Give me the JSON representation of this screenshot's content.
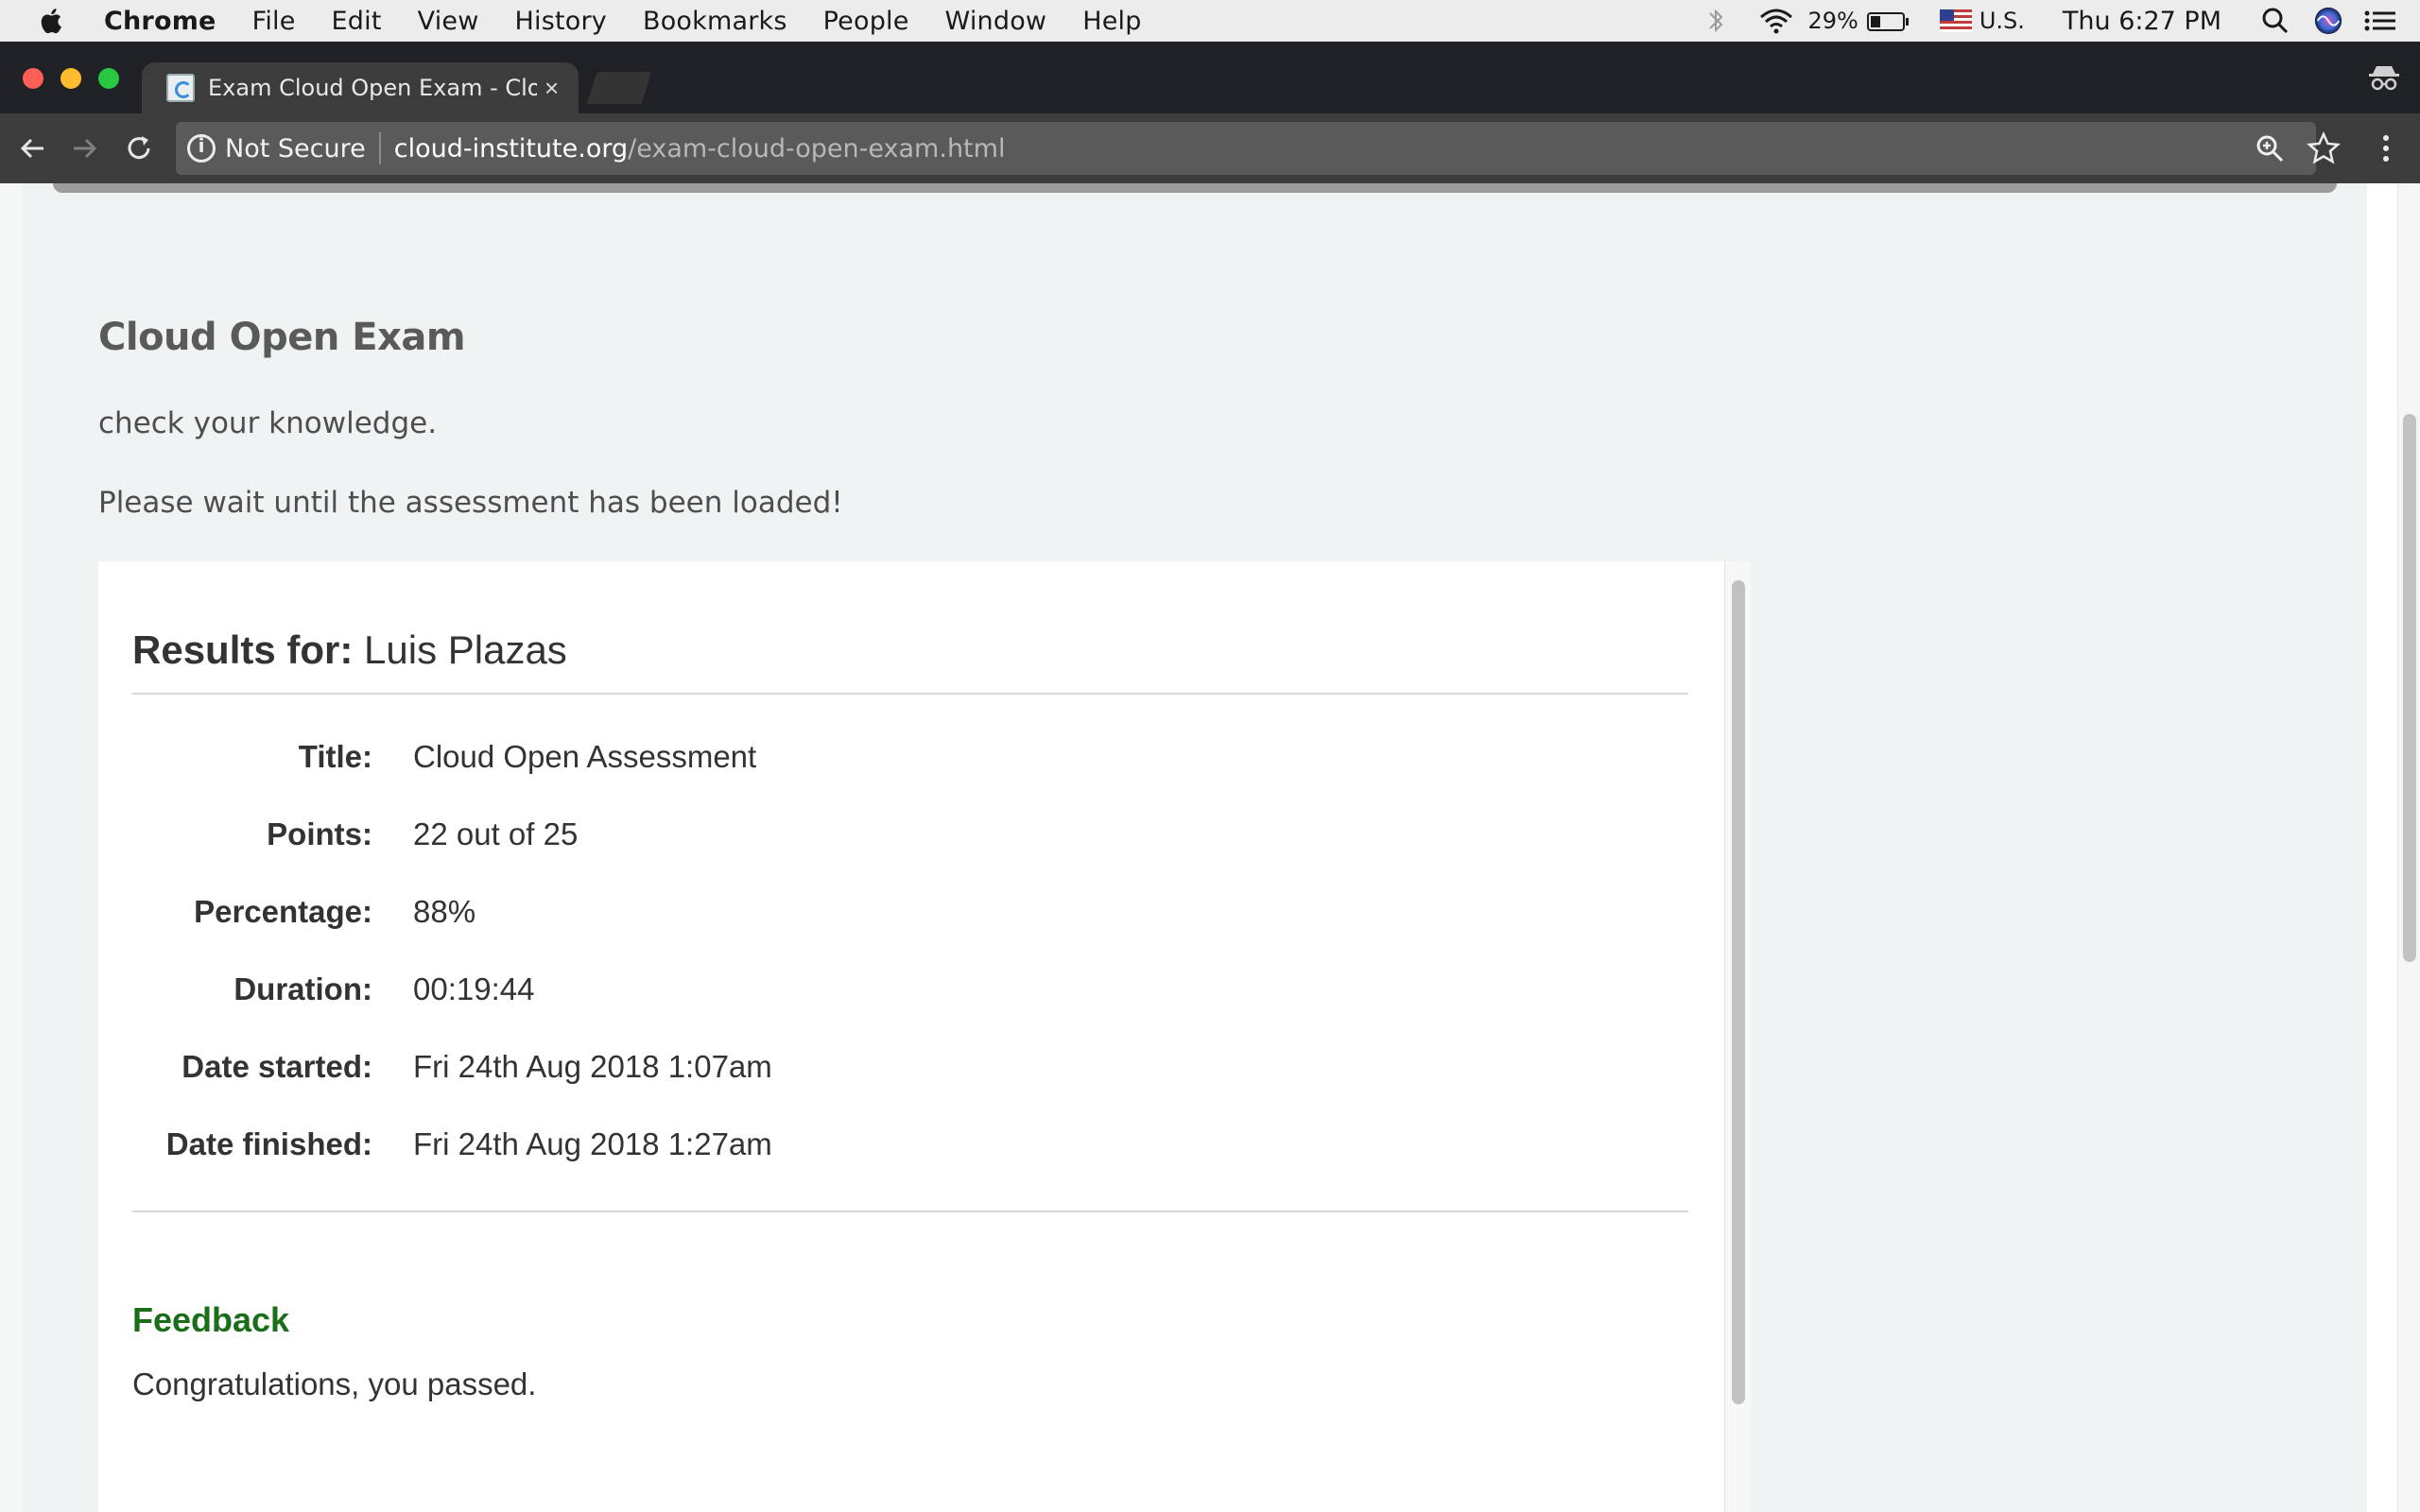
{
  "menubar": {
    "app": "Chrome",
    "items": [
      "File",
      "Edit",
      "View",
      "History",
      "Bookmarks",
      "People",
      "Window",
      "Help"
    ],
    "battery": "29%",
    "input_source": "U.S.",
    "clock": "Thu 6:27 PM"
  },
  "browser": {
    "tab_title": "Exam Cloud Open Exam - Clou",
    "tab_close": "×",
    "security_label": "Not Secure",
    "url_host": "cloud-institute.org",
    "url_path": "/exam-cloud-open-exam.html"
  },
  "page": {
    "title": "Cloud Open Exam",
    "subtitle": "check your knowledge.",
    "wait_message": "Please wait until the assessment has been loaded!",
    "results": {
      "heading_label": "Results for:",
      "heading_name": "Luis Plazas",
      "rows": [
        {
          "label": "Title:",
          "value": "Cloud Open Assessment"
        },
        {
          "label": "Points:",
          "value": "22 out of 25"
        },
        {
          "label": "Percentage:",
          "value": "88%"
        },
        {
          "label": "Duration:",
          "value": "00:19:44"
        },
        {
          "label": "Date started:",
          "value": "Fri 24th Aug 2018 1:07am"
        },
        {
          "label": "Date finished:",
          "value": "Fri 24th Aug 2018 1:27am"
        }
      ],
      "feedback_heading": "Feedback",
      "feedback_text": "Congratulations, you passed."
    }
  },
  "colors": {
    "feedback_green": "#1a6e1a",
    "page_background": "#f0f3f3",
    "chrome_dark": "#202124"
  }
}
